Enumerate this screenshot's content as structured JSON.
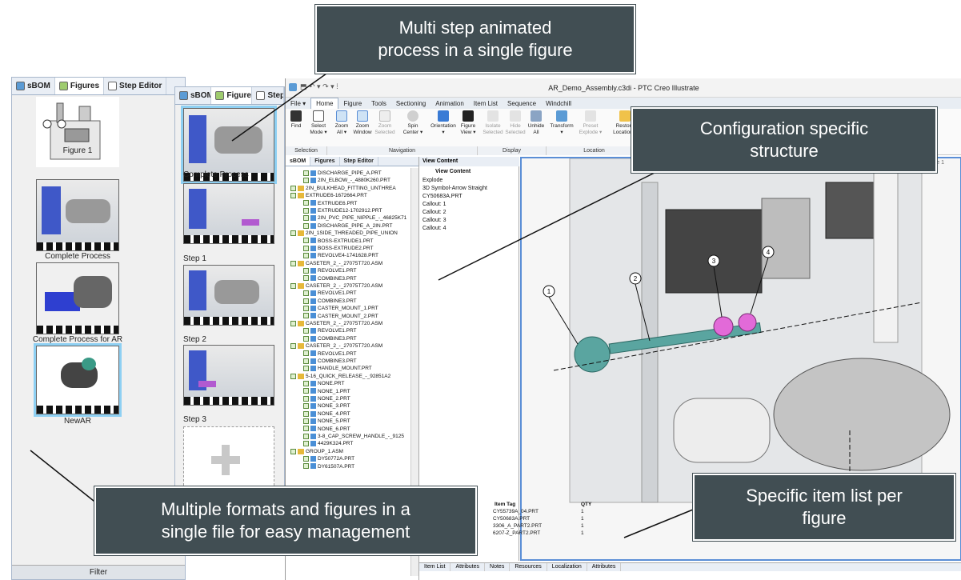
{
  "callouts": {
    "top": [
      "Multi step animated",
      "process in a single figure"
    ],
    "right_top": [
      "Configuration specific",
      "structure"
    ],
    "bottom_left": [
      "Multiple formats and figures in a",
      "single file for easy management"
    ],
    "bottom_right": [
      "Specific item list per",
      "figure"
    ]
  },
  "left_panel": {
    "tabs": [
      "sBOM",
      "Figures",
      "Step Editor"
    ],
    "thumbnails": [
      "Figure 1",
      "Complete Process",
      "Complete Process for AR",
      "NewAR"
    ],
    "filter": "Filter"
  },
  "step_panel": {
    "tabs": [
      "sBOM",
      "Figures",
      "Step"
    ],
    "steps": [
      "Complete Process",
      "Step 1",
      "Step 2",
      "Step 3"
    ]
  },
  "app": {
    "title": "AR_Demo_Assembly.c3di - PTC Creo Illustrate",
    "menu": [
      "File ▾",
      "Home",
      "Figure",
      "Tools",
      "Sectioning",
      "Animation",
      "Item List",
      "Sequence",
      "Windchill"
    ],
    "ribbon_buttons": [
      [
        "Find",
        ""
      ],
      [
        "Select",
        "Mode ▾"
      ],
      [
        "Zoom",
        "All ▾"
      ],
      [
        "Zoom",
        "Window"
      ],
      [
        "Zoom",
        "Selected"
      ],
      [
        "Spin",
        "Center ▾"
      ],
      [
        "Orientation",
        "▾"
      ],
      [
        "Figure",
        "View ▾"
      ],
      [
        "Isolate",
        "Selected"
      ],
      [
        "Hide",
        "Selected"
      ],
      [
        "Unhide",
        "All"
      ],
      [
        "Transform",
        "▾"
      ],
      [
        "Preset",
        "Explode ▾"
      ],
      [
        "Restore",
        "Location ▾"
      ]
    ],
    "ribbon_groups": [
      "Selection",
      "Navigation",
      "Display",
      "Location"
    ],
    "tree_tabs": [
      "sBOM",
      "Figures",
      "Step Editor"
    ],
    "tree": [
      "DISCHARGE_PIPE_A.PRT",
      "2IN_ELBOW_-_4880K260.PRT",
      "2IN_BULKHEAD_FITTING_UNTHREA",
      "EXTRUDE6-1672664.PRT",
      "EXTRUDE6.PRT",
      "EXTRUDE12-1702912.PRT",
      "2IN_PVC_PIPE_NIPPLE_-_46825K71",
      "DISCHARGE_PIPE_A_2IN.PRT",
      "2IN_1SIDE_THREADED_PIPE_UNION",
      "BOSS-EXTRUDE1.PRT",
      "BOSS-EXTRUDE2.PRT",
      "REVOLVE4-1741628.PRT",
      "CASETER_2_-_27075T720.ASM",
      "REVOLVE1.PRT",
      "COMBINE3.PRT",
      "CASETER_2_-_27075T720.ASM",
      "REVOLVE1.PRT",
      "COMBINE3.PRT",
      "CASTER_MOUNT_1.PRT",
      "CASTER_MOUNT_2.PRT",
      "CASETER_2_-_27075T720.ASM",
      "REVOLVE1.PRT",
      "COMBINE3.PRT",
      "CASETER_2_-_27075T720.ASM",
      "REVOLVE1.PRT",
      "COMBINE3.PRT",
      "HANDLE_MOUNT.PRT",
      "5-16_QUICK_RELEASE_-_92851A2",
      "NONE.PRT",
      "NONE_1.PRT",
      "NONE_2.PRT",
      "NONE_3.PRT",
      "NONE_4.PRT",
      "NONE_5.PRT",
      "NONE_6.PRT",
      "3-8_CAP_SCREW_HANDLE_-_9125",
      "4429K324.PRT",
      "GROUP_1.ASM",
      "DY50772A.PRT",
      "DY61507A.PRT"
    ],
    "view_content_tab": "View Content",
    "view_content": [
      "View Content",
      "Explode",
      "3D Symbol-Arrow Straight",
      "CY50683A.PRT",
      "Callout: 1",
      "Callout: 2",
      "Callout: 3",
      "Callout: 4"
    ],
    "viewport_label": "Figure 1",
    "callout_numbers": [
      "1",
      "2",
      "3",
      "4"
    ],
    "itemlist_tabs": [
      "Item List",
      "Attributes",
      "Notes",
      "Resources",
      "Localization",
      "Attributes"
    ],
    "itemlist_header": [
      "Item Tag",
      "QTY"
    ],
    "itemlist_rows": [
      [
        "CY55739A_04.PRT",
        "1"
      ],
      [
        "CY50683A.PRT",
        "1"
      ],
      [
        "3306_A_PART2.PRT",
        "1"
      ],
      [
        "6207-Z_PART2.PRT",
        "1"
      ]
    ]
  }
}
